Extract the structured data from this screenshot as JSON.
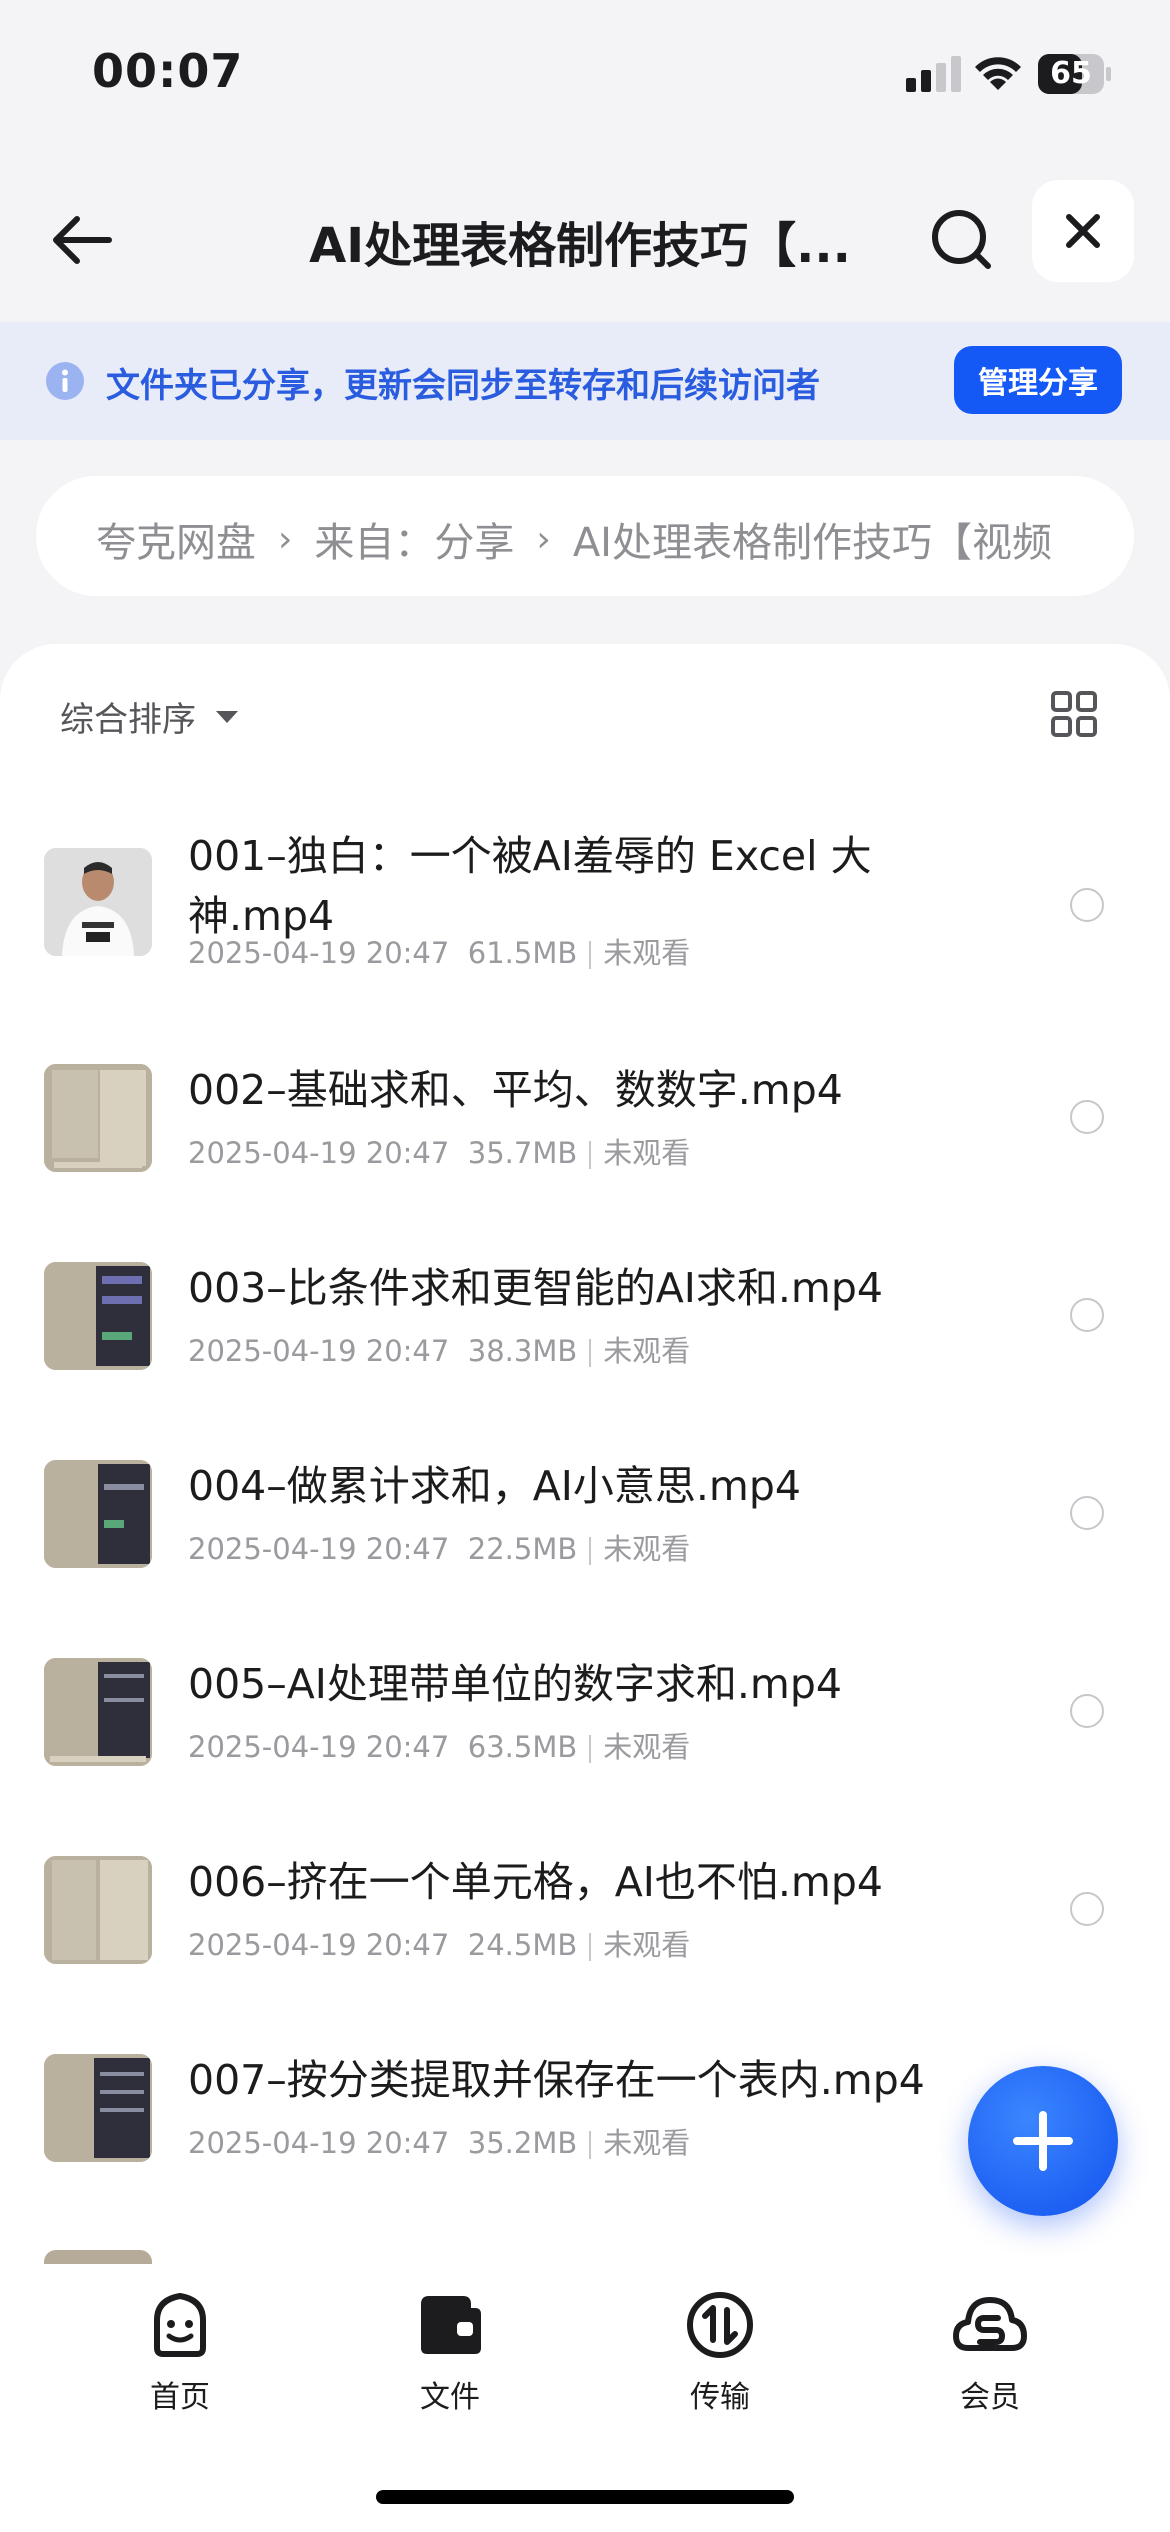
{
  "status": {
    "time": "00:07",
    "battery": "65"
  },
  "header": {
    "title": "AI处理表格制作技巧【..."
  },
  "banner": {
    "text": "文件夹已分享，更新会同步至转存和后续访问者",
    "button": "管理分享"
  },
  "breadcrumb": {
    "items": [
      "夸克网盘",
      "来自：分享",
      "AI处理表格制作技巧【视频"
    ]
  },
  "sort": {
    "label": "综合排序"
  },
  "files": [
    {
      "name": "001–独白：一个被AI羞辱的 Excel 大神.mp4",
      "date": "2025-04-19 20:47",
      "size": "61.5MB",
      "status": "未观看"
    },
    {
      "name": "002–基础求和、平均、数数字.mp4",
      "date": "2025-04-19 20:47",
      "size": "35.7MB",
      "status": "未观看"
    },
    {
      "name": "003–比条件求和更智能的AI求和.mp4",
      "date": "2025-04-19 20:47",
      "size": "38.3MB",
      "status": "未观看"
    },
    {
      "name": "004–做累计求和，AI小意思.mp4",
      "date": "2025-04-19 20:47",
      "size": "22.5MB",
      "status": "未观看"
    },
    {
      "name": "005–AI处理带单位的数字求和.mp4",
      "date": "2025-04-19 20:47",
      "size": "63.5MB",
      "status": "未观看"
    },
    {
      "name": "006–挤在一个单元格，AI也不怕.mp4",
      "date": "2025-04-19 20:47",
      "size": "24.5MB",
      "status": "未观看"
    },
    {
      "name": "007–按分类提取并保存在一个表内.mp4",
      "date": "2025-04-19 20:47",
      "size": "35.2MB",
      "status": "未观看"
    }
  ],
  "tabs": [
    {
      "label": "首页",
      "icon": "smile-face-icon"
    },
    {
      "label": "文件",
      "icon": "wallet-folder-icon"
    },
    {
      "label": "传输",
      "icon": "transfer-arrows-icon"
    },
    {
      "label": "会员",
      "icon": "cloud-s-icon"
    }
  ],
  "colors": {
    "accent": "#1458f5",
    "banner_bg": "#e8ecf8",
    "banner_text": "#2a5ce0"
  }
}
